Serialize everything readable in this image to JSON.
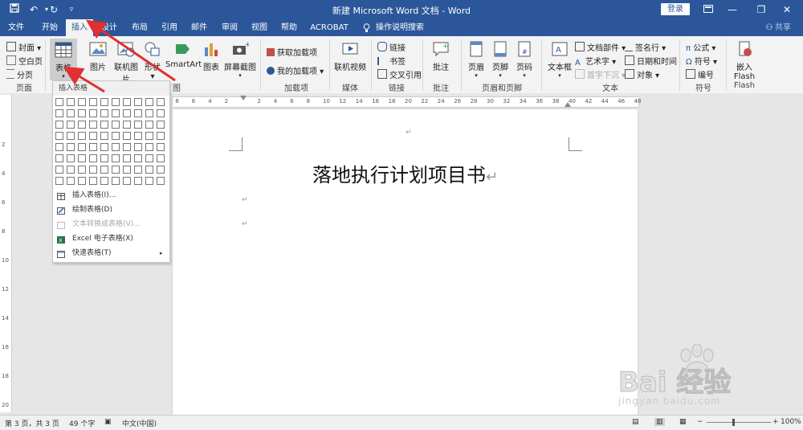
{
  "window": {
    "title": "新建 Microsoft Word 文档 - Word",
    "login_label": "登录"
  },
  "tabs": [
    "文件",
    "开始",
    "插入",
    "设计",
    "布局",
    "引用",
    "邮件",
    "审阅",
    "视图",
    "帮助",
    "ACROBAT",
    "操作说明搜索"
  ],
  "share_label": "共享",
  "ribbon": {
    "pages": {
      "cover": "封面",
      "blank": "空白页",
      "break": "分页",
      "group": "页面"
    },
    "table": {
      "label": "表格"
    },
    "illustrations": {
      "picture": "图片",
      "online_picture": "联机图片",
      "shapes": "形状",
      "smartart": "SmartArt",
      "chart": "图表",
      "screenshot": "屏幕截图",
      "group": "图"
    },
    "addins": {
      "get": "获取加载项",
      "my": "我的加载项",
      "group": "加载项"
    },
    "media": {
      "online_video": "联机视频",
      "group": "媒体"
    },
    "links": {
      "link": "链接",
      "bookmark": "书签",
      "cross_ref": "交叉引用",
      "group": "链接"
    },
    "comments": {
      "comment": "批注",
      "group": "批注"
    },
    "header_footer": {
      "header": "页眉",
      "footer": "页脚",
      "page_number": "页码",
      "group": "页眉和页脚"
    },
    "text": {
      "textbox": "文本框",
      "doc_parts": "文档部件",
      "wordart": "艺术字",
      "dropcap": "首字下沉",
      "signature": "签名行",
      "datetime": "日期和时间",
      "object": "对象",
      "group": "文本"
    },
    "symbols": {
      "equation": "公式",
      "symbol": "符号",
      "number": "编号",
      "group": "符号"
    },
    "flash": {
      "embed": "嵌入",
      "flash1": "Flash",
      "flash2": "Flash"
    }
  },
  "dropdown": {
    "header": "插入表格",
    "grid_cols": 10,
    "grid_rows": 8,
    "items": [
      {
        "label": "插入表格(I)...",
        "disabled": false
      },
      {
        "label": "绘制表格(D)",
        "disabled": false
      },
      {
        "label": "文本转换成表格(V)...",
        "disabled": true
      },
      {
        "label": "Excel 电子表格(X)",
        "disabled": false
      },
      {
        "label": "快速表格(T)",
        "disabled": false
      }
    ]
  },
  "ruler": {
    "left_numbers": [
      "8",
      "6",
      "4",
      "2"
    ],
    "right_numbers": [
      "2",
      "4",
      "6",
      "8",
      "10",
      "12",
      "14",
      "16",
      "18",
      "20",
      "22",
      "24",
      "26",
      "28",
      "30",
      "32",
      "34",
      "36",
      "38",
      "40",
      "42",
      "44",
      "46",
      "48"
    ],
    "vertical_numbers": [
      "2",
      "4",
      "6",
      "8",
      "10",
      "12",
      "14",
      "16",
      "18",
      "20"
    ]
  },
  "document": {
    "heading": "落地执行计划项目书",
    "paragraph_mark": "↵"
  },
  "status": {
    "page": "第 3 页，共 3 页",
    "words": "49 个字",
    "language": "中文(中国)",
    "zoom": "100%"
  },
  "watermark": {
    "text": "Bai 经验",
    "sub": "jingyan.baidu.com"
  },
  "colors": {
    "accent": "#2b579a",
    "ribbon_bg": "#f3f3f3",
    "annotation_arrow": "#e03030"
  }
}
